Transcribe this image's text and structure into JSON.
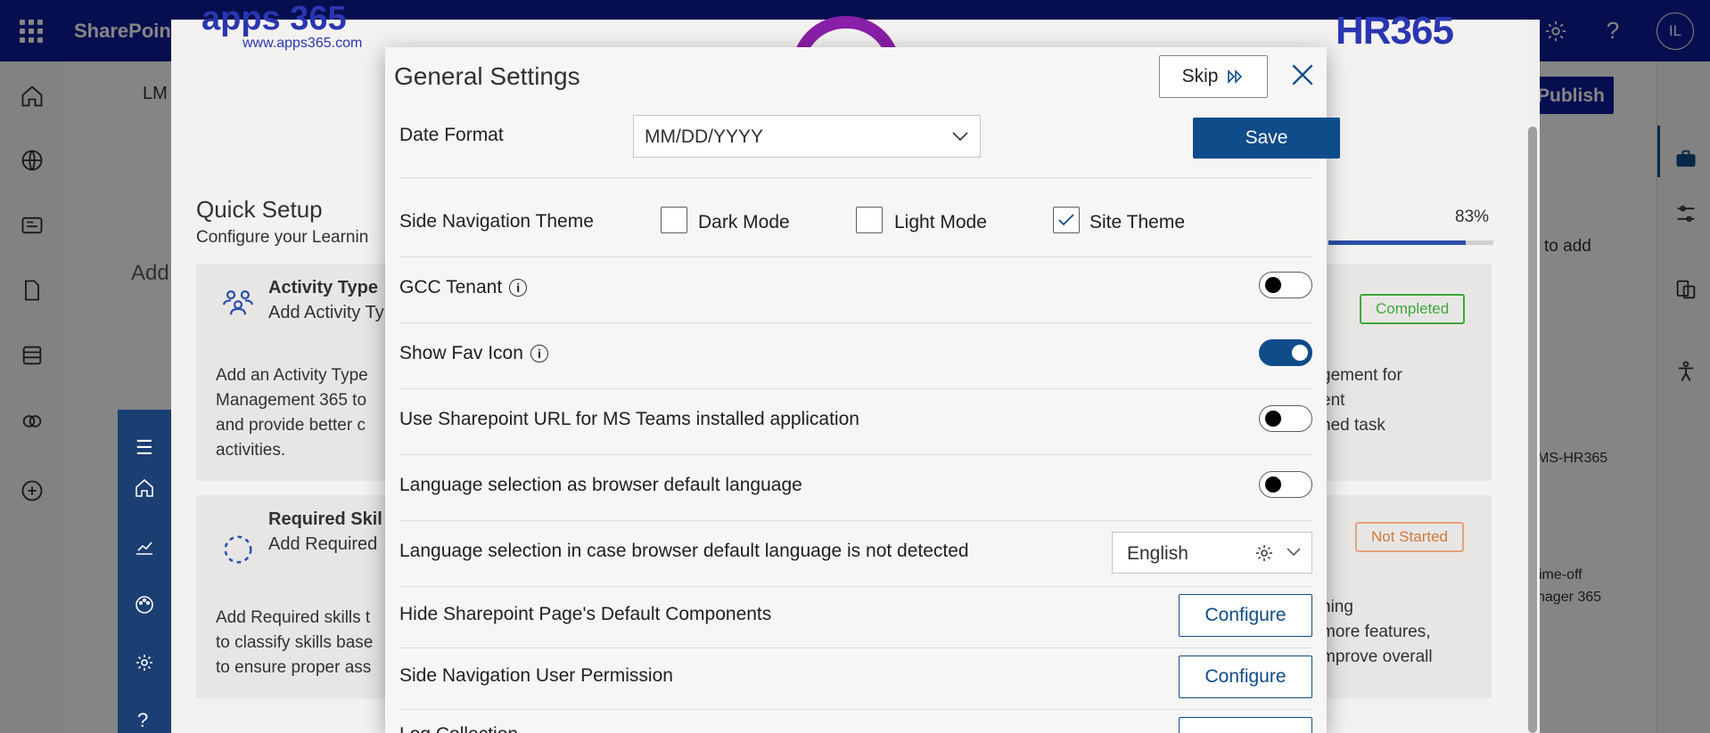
{
  "suitebar": {
    "app_name": "SharePoint",
    "avatar_initials": "IL",
    "icons": [
      "waffle-icon",
      "settings-icon",
      "help-icon"
    ]
  },
  "background": {
    "page_title_fragment": "LM",
    "publish_label": "Publish",
    "add_text_fragment": "Add",
    "right_hint": "to add",
    "apps": [
      "MS-HR365",
      "ime-off",
      "nager 365"
    ]
  },
  "quick_setup": {
    "logo_text": "apps 365",
    "logo_url": "www.apps365.com",
    "brand": "HR365",
    "title": "Quick Setup",
    "subtitle": "Configure your Learnin",
    "progress_percent": 83,
    "progress_label": "83%",
    "cards": [
      {
        "title": "Activity Type",
        "subtitle": "Add Activity Ty",
        "status": "Completed",
        "desc": [
          "Add an Activity Type",
          "Management 365 to",
          "and provide better c",
          "activities."
        ],
        "right_desc": [
          "gement for",
          "ent",
          "ned task"
        ]
      },
      {
        "title": "Required Skil",
        "subtitle": "Add Required",
        "status": "Not Started",
        "desc": [
          "Add Required skills t",
          "to classify skills base",
          "to ensure proper ass"
        ],
        "right_desc": [
          "ning",
          "more features,",
          "mprove overall"
        ]
      }
    ]
  },
  "modal": {
    "title": "General Settings",
    "skip_label": "Skip",
    "save_label": "Save",
    "date_format": {
      "label": "Date Format",
      "value": "MM/DD/YYYY"
    },
    "side_nav_theme": {
      "label": "Side Navigation Theme",
      "options": [
        {
          "label": "Dark Mode",
          "checked": false
        },
        {
          "label": "Light Mode",
          "checked": false
        },
        {
          "label": "Site Theme",
          "checked": true
        }
      ]
    },
    "gcc_tenant": {
      "label": "GCC Tenant",
      "on": false
    },
    "show_fav_icon": {
      "label": "Show Fav Icon",
      "on": true
    },
    "sharepoint_url": {
      "label": "Use Sharepoint URL for MS Teams installed application",
      "on": false
    },
    "lang_browser_default": {
      "label": "Language selection as browser default language",
      "on": false
    },
    "lang_fallback": {
      "label": "Language selection in case browser default language is not detected",
      "value": "English"
    },
    "hide_components": {
      "label": "Hide Sharepoint Page's Default Components",
      "button": "Configure"
    },
    "side_nav_permission": {
      "label": "Side Navigation User Permission",
      "button": "Configure"
    },
    "partial_row": {
      "label": "Log Collection"
    }
  },
  "colors": {
    "suitebar": "#0f1b9a",
    "primary": "#0f4c8a",
    "completed": "#3da83d",
    "not_started": "#d07a3e"
  }
}
